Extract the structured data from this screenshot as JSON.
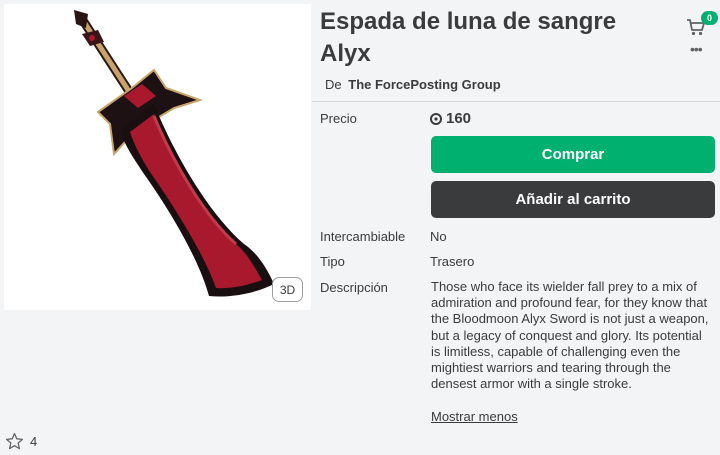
{
  "item": {
    "title": "Espada de luna de sangre Alyx",
    "creator_prefix": "De",
    "creator_name": "The ForcePosting Group",
    "favorites": "4"
  },
  "thumbnail": {
    "view_3d_label": "3D"
  },
  "cart": {
    "count": "0"
  },
  "purchase": {
    "price_label": "Precio",
    "price_value": "160",
    "buy_label": "Comprar",
    "add_to_cart_label": "Añadir al carrito"
  },
  "info": {
    "tradable_label": "Intercambiable",
    "tradable_value": "No",
    "type_label": "Tipo",
    "type_value": "Trasero",
    "description_label": "Descripción",
    "description_text": "Those who face its wielder fall prey to a mix of admiration and profound fear, for they know that the Bloodmoon Alyx Sword is not just a weapon, but a legacy of conquest and glory. Its potential is limitless, capable of challenging even the mightiest warriors and tearing through the densest armor with a single stroke.",
    "show_less_label": "Mostrar menos"
  },
  "colors": {
    "accent_green": "#00b06f",
    "dark_button": "#393b3d",
    "blade_red": "#a8192e"
  }
}
